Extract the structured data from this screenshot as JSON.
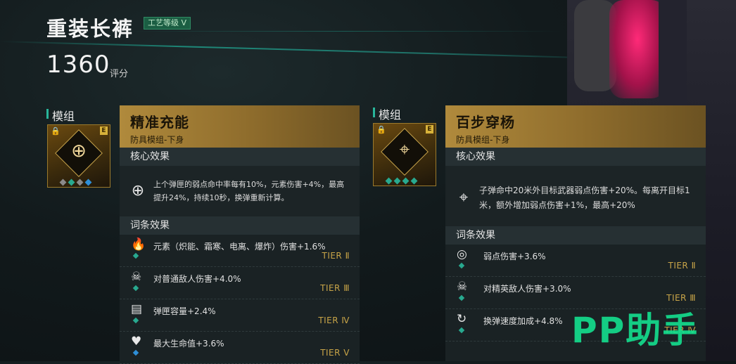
{
  "header": {
    "item_name": "重装长裤",
    "craft_badge": "工艺等级 V",
    "score": "1360",
    "score_label": "评分"
  },
  "colors": {
    "accent_teal": "#28b59a",
    "gold": "#b08a3c",
    "tier_gold": "#c9a548",
    "watermark": "#14e08f"
  },
  "mods": [
    {
      "section_label": "模组",
      "icon": "crosshair-icon",
      "rarity": "E",
      "slots": [
        "#8a8a8a",
        "#28a98f",
        "#8a8a8a",
        "#2e8fd8"
      ],
      "name": "精准充能",
      "subtitle": "防具模组-下身",
      "core_label": "核心效果",
      "core_text": "上个弹匣的弱点命中率每有10%，元素伤害+4%，最高提升24%，持续10秒，换弹重新计算。",
      "perks_label": "词条效果",
      "perks": [
        {
          "icon": "element-icon",
          "text": "元素（炽能、霜寒、电离、爆炸）伤害+1.6%",
          "tier": "TIER Ⅱ"
        },
        {
          "icon": "enemy-icon",
          "text": "对普通敌人伤害+4.0%",
          "tier": "TIER Ⅲ"
        },
        {
          "icon": "magazine-icon",
          "text": "弹匣容量+2.4%",
          "tier": "TIER Ⅳ"
        },
        {
          "icon": "heart-icon",
          "text": "最大生命值+3.6%",
          "tier": "TIER Ⅴ"
        }
      ]
    },
    {
      "section_label": "模组",
      "icon": "sniper-rifle-icon",
      "rarity": "E",
      "slots": [
        "#28a98f",
        "#28a98f",
        "#28a98f",
        "#28a98f"
      ],
      "name": "百步穿杨",
      "subtitle": "防具模组-下身",
      "core_label": "核心效果",
      "core_text": "子弹命中20米外目标武器弱点伤害+20%。每离开目标1米，额外增加弱点伤害+1%，最高+20%",
      "perks_label": "词条效果",
      "perks": [
        {
          "icon": "weakpoint-icon",
          "text": "弱点伤害+3.6%",
          "tier": "TIER Ⅱ"
        },
        {
          "icon": "elite-enemy-icon",
          "text": "对精英敌人伤害+3.0%",
          "tier": "TIER Ⅲ"
        },
        {
          "icon": "reload-icon",
          "text": "换弹速度加成+4.8%",
          "tier": "TIER Ⅳ"
        }
      ]
    }
  ],
  "watermark": "PP助手"
}
